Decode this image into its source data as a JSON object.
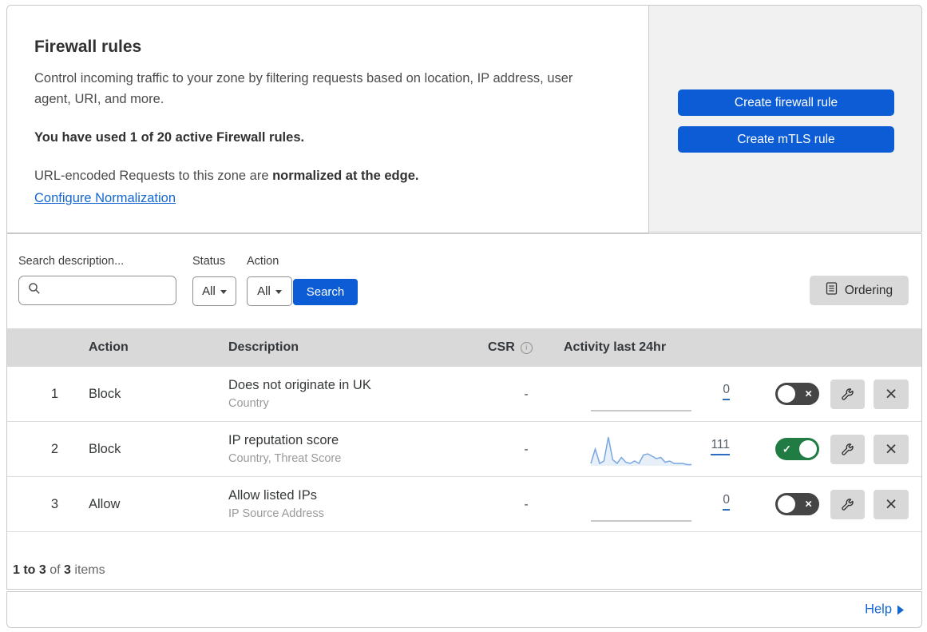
{
  "overview": {
    "title": "Firewall rules",
    "description": "Control incoming traffic to your zone by filtering requests based on location, IP address, user agent, URI, and more.",
    "usage_note": "You have used 1 of 20 active Firewall rules.",
    "normalization_text": "URL-encoded Requests to this zone are ",
    "normalization_bold": "normalized at the edge.",
    "normalization_link": "Configure Normalization",
    "buttons": {
      "create_firewall": "Create firewall rule",
      "create_mtls": "Create mTLS rule"
    }
  },
  "filters": {
    "search_label": "Search description...",
    "search_value": "",
    "search_placeholder": "",
    "status_label": "Status",
    "status_value": "All",
    "action_label": "Action",
    "action_value": "All",
    "search_button": "Search",
    "ordering_button": "Ordering"
  },
  "table": {
    "headers": {
      "action": "Action",
      "description": "Description",
      "csr": "CSR",
      "activity": "Activity last 24hr"
    },
    "rows": [
      {
        "num": "1",
        "action": "Block",
        "title": "Does not originate in UK",
        "subtitle": "Country",
        "csr": "-",
        "count": "0",
        "enabled": false
      },
      {
        "num": "2",
        "action": "Block",
        "title": "IP reputation score",
        "subtitle": "Country, Threat Score",
        "csr": "-",
        "count": "111",
        "enabled": true
      },
      {
        "num": "3",
        "action": "Allow",
        "title": "Allow listed IPs",
        "subtitle": "IP Source Address",
        "csr": "-",
        "count": "0",
        "enabled": false
      }
    ],
    "footer": {
      "range": "1 to 3",
      "of": "of",
      "total": "3",
      "items": "items"
    }
  },
  "help_link": "Help",
  "icons": {
    "info_glyph": "i",
    "x_glyph": "×",
    "check_glyph": "✓",
    "search": "magnifier",
    "ordering": "document-list",
    "edit": "wrench",
    "delete": "x"
  },
  "colors": {
    "primary_blue": "#0b5cd5",
    "link_blue": "#1467d2",
    "toggle_on_green": "#217c43",
    "toggle_off_gray": "#454545",
    "sparkline_blue": "#7aa7e0",
    "flatline_gray": "#b5b5b5",
    "table_header_gray": "#d9d9d9",
    "panel_gray": "#f1f1f1"
  },
  "chart_data": [
    {
      "type": "area",
      "title": "Rule 1 activity last 24hr",
      "x_range": "last 24 hours",
      "values": [
        0,
        0,
        0,
        0,
        0,
        0,
        0,
        0,
        0,
        0,
        0,
        0,
        0,
        0,
        0,
        0,
        0,
        0,
        0,
        0,
        0,
        0,
        0,
        0
      ],
      "total": 0,
      "color": "#b5b5b5",
      "fill": "none"
    },
    {
      "type": "area",
      "title": "Rule 2 activity last 24hr",
      "x_range": "last 24 hours",
      "values": [
        2,
        14,
        2,
        4,
        24,
        5,
        2,
        7,
        3,
        2,
        4,
        2,
        9,
        10,
        8,
        6,
        7,
        3,
        4,
        2,
        2,
        2,
        1,
        1
      ],
      "total": 111,
      "color": "#7aa7e0",
      "fill": "rgba(122,167,224,0.18)"
    },
    {
      "type": "area",
      "title": "Rule 3 activity last 24hr",
      "x_range": "last 24 hours",
      "values": [
        0,
        0,
        0,
        0,
        0,
        0,
        0,
        0,
        0,
        0,
        0,
        0,
        0,
        0,
        0,
        0,
        0,
        0,
        0,
        0,
        0,
        0,
        0,
        0
      ],
      "total": 0,
      "color": "#b5b5b5",
      "fill": "none"
    }
  ]
}
